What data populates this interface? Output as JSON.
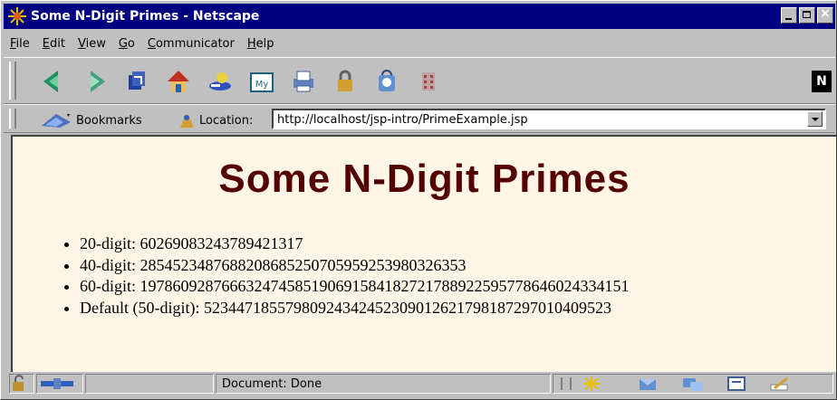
{
  "window": {
    "title": "Some N-Digit Primes - Netscape"
  },
  "menu": [
    "File",
    "Edit",
    "View",
    "Go",
    "Communicator",
    "Help"
  ],
  "nav_icons": [
    "back-icon",
    "forward-icon",
    "reload-icon",
    "home-icon",
    "search-icon",
    "my-netscape-icon",
    "print-icon",
    "security-icon",
    "shop-icon",
    "stop-icon"
  ],
  "location_bar": {
    "bookmarks_label": "Bookmarks",
    "location_label": "Location:",
    "url": "http://localhost/jsp-intro/PrimeExample.jsp"
  },
  "page": {
    "heading": "Some N-Digit Primes",
    "primes": [
      "20-digit: 60269083243789421317",
      "40-digit: 2854523487688208685250705959253980326353",
      "60-digit: 197860928766632474585190691584182721788922595778646024334151",
      "Default (50-digit): 52344718557980924342452309012621798187297010409523"
    ]
  },
  "status": {
    "text": "Document: Done"
  },
  "colors": {
    "titlebar": "#000080",
    "page_bg": "#fdf5e6",
    "heading": "#550000"
  }
}
